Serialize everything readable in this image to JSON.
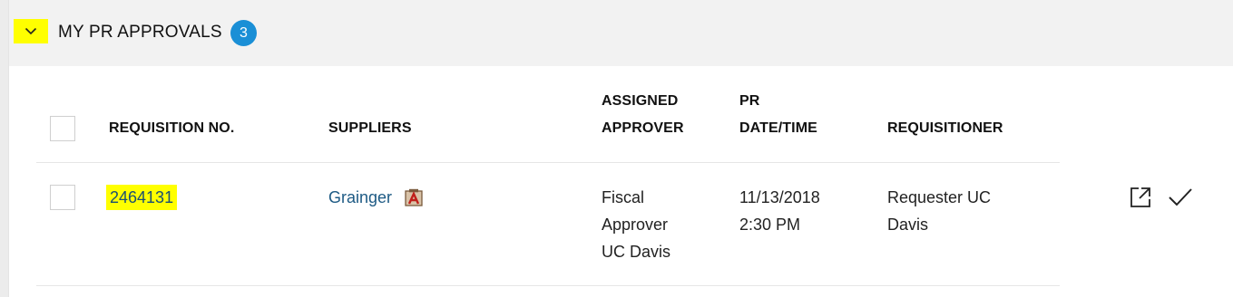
{
  "section": {
    "title": "MY PR APPROVALS",
    "count": "3"
  },
  "table": {
    "headers": {
      "requisition_no": "REQUISITION NO.",
      "suppliers": "SUPPLIERS",
      "assigned_approver_1": "ASSIGNED",
      "assigned_approver_2": "APPROVER",
      "pr_datetime_1": "PR",
      "pr_datetime_2": "DATE/TIME",
      "requisitioner": "REQUISITIONER"
    },
    "rows": [
      {
        "requisition_no": "2464131",
        "supplier": "Grainger",
        "approver_line1": "Fiscal",
        "approver_line2": "Approver",
        "approver_line3": "UC Davis",
        "date": "11/13/2018",
        "time": "2:30 PM",
        "requisitioner_line1": "Requester UC",
        "requisitioner_line2": "Davis"
      }
    ]
  },
  "icons": {
    "toggle": "chevron-down-icon",
    "supplier_badge": "supplier-catalog-icon",
    "open_external": "open-external-icon",
    "approve": "checkmark-icon"
  },
  "colors": {
    "highlight": "#ffff00",
    "badge": "#1a8fd6",
    "link": "#1d5a84"
  }
}
